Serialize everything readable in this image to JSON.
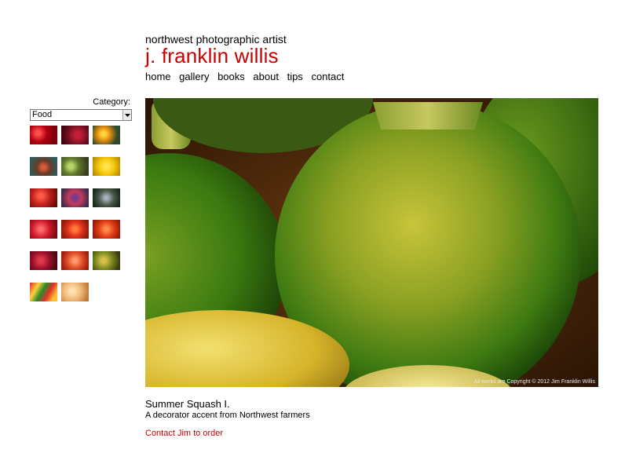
{
  "header": {
    "tagline": "northwest photographic artist",
    "site_name": "j. franklin willis",
    "nav": [
      "home",
      "gallery",
      "books",
      "about",
      "tips",
      "contact"
    ]
  },
  "sidebar": {
    "category_label": "Category:",
    "category_selected": "Food",
    "thumbnail_count": 17
  },
  "photo": {
    "copyright": "All works are Copyright © 2012 Jim Franklin Willis"
  },
  "caption": {
    "title": "Summer Squash I.",
    "description": "A decorator accent from Northwest farmers",
    "order_link": "Contact Jim to order"
  },
  "colors": {
    "accent": "#cc0000",
    "text": "#000000",
    "background": "#ffffff"
  }
}
